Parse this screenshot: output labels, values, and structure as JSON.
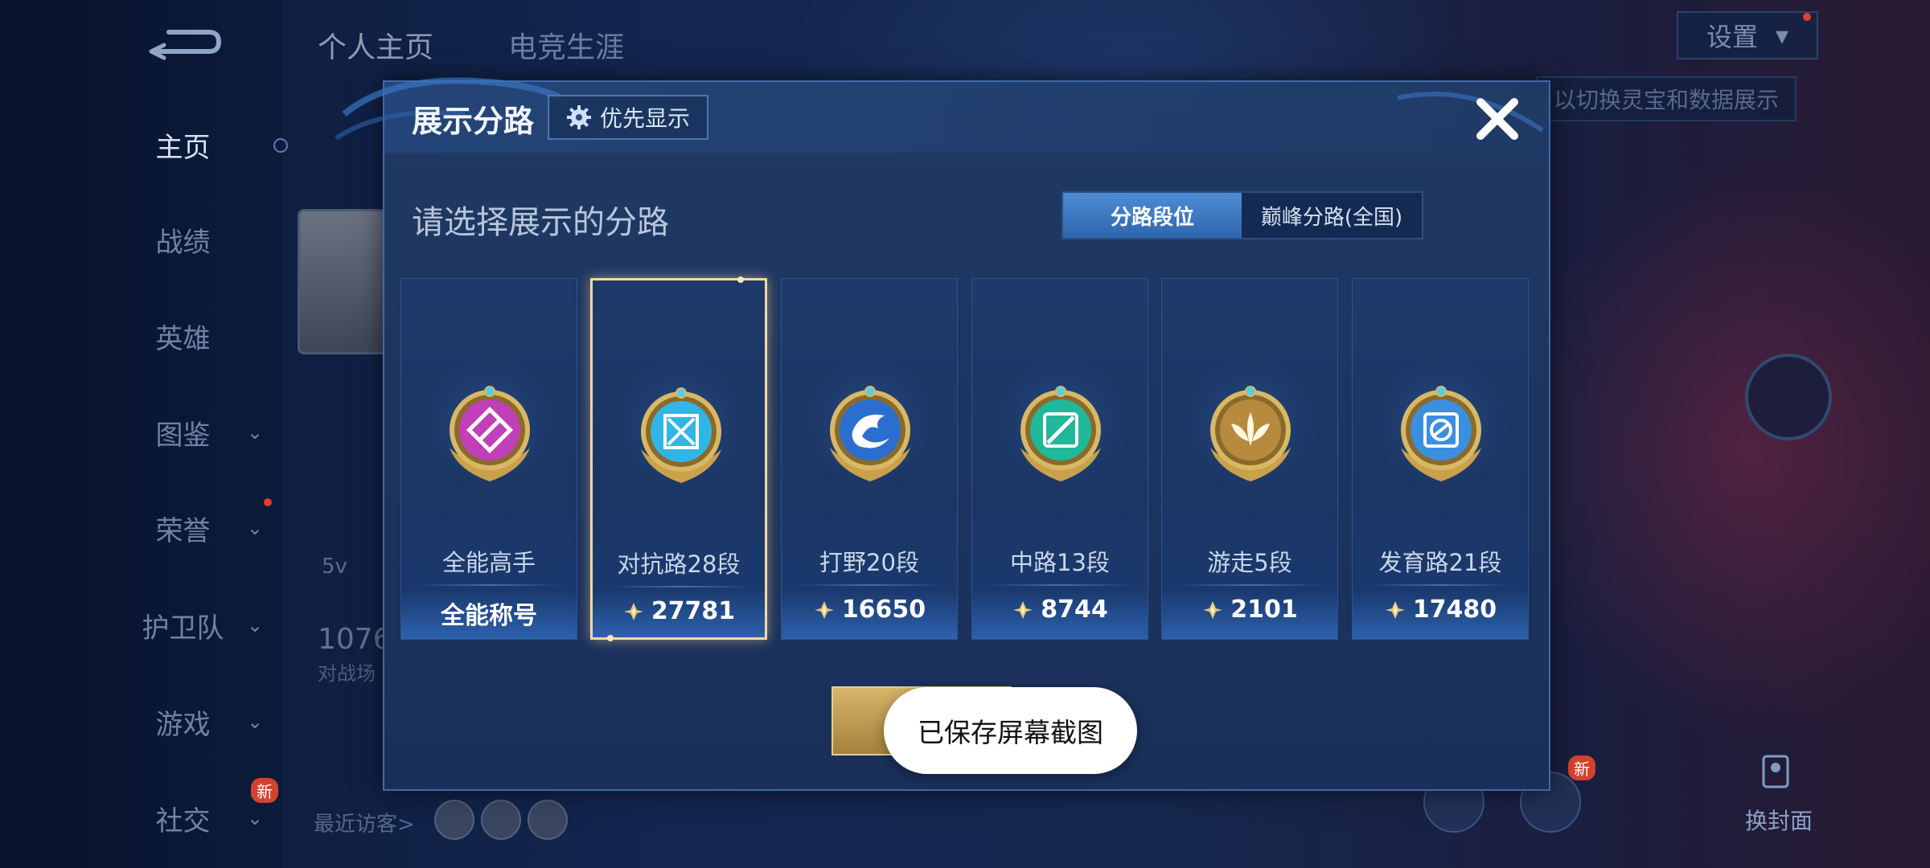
{
  "top_tabs": [
    "个人主页",
    "电竞生涯"
  ],
  "settings_label": "设置",
  "hint_text": "以切换灵宝和数据展示",
  "sidebar": {
    "items": [
      {
        "label": "主页",
        "active": true
      },
      {
        "label": "战绩"
      },
      {
        "label": "英雄"
      },
      {
        "label": "图鉴",
        "chevron": true
      },
      {
        "label": "荣誉",
        "chevron": true
      },
      {
        "label": "护卫队",
        "chevron": true
      },
      {
        "label": "游戏",
        "chevron": true
      },
      {
        "label": "社交",
        "chevron": true
      }
    ],
    "new_badge": "新"
  },
  "profile": {
    "rank_value": "1076",
    "rank_sub": "对战场",
    "level_partial": "5v",
    "visitors_label": "最近访客>"
  },
  "right": {
    "cover_label": "换封面",
    "new_badge": "新"
  },
  "modal": {
    "title": "展示分路",
    "priority_label": "优先显示",
    "subtitle": "请选择展示的分路",
    "segments": [
      "分路段位",
      "巅峰分路(全国)"
    ],
    "selected_segment": 0,
    "cards": [
      {
        "name": "全能高手",
        "score": "全能称号",
        "has_points": false,
        "selected": false,
        "badge": "allround-badge-icon",
        "color": "#c13fb8"
      },
      {
        "name": "对抗路28段",
        "score": "27781",
        "has_points": true,
        "selected": true,
        "badge": "clash-lane-badge-icon",
        "color": "#2fb6e6"
      },
      {
        "name": "打野20段",
        "score": "16650",
        "has_points": true,
        "selected": false,
        "badge": "jungle-badge-icon",
        "color": "#2a6fd0"
      },
      {
        "name": "中路13段",
        "score": "8744",
        "has_points": true,
        "selected": false,
        "badge": "mid-lane-badge-icon",
        "color": "#1fb89a"
      },
      {
        "name": "游走5段",
        "score": "2101",
        "has_points": true,
        "selected": false,
        "badge": "roam-badge-icon",
        "color": "#b88a3e"
      },
      {
        "name": "发育路21段",
        "score": "17480",
        "has_points": true,
        "selected": false,
        "badge": "farm-lane-badge-icon",
        "color": "#3a8fe0"
      }
    ]
  },
  "toast": "已保存屏幕截图"
}
